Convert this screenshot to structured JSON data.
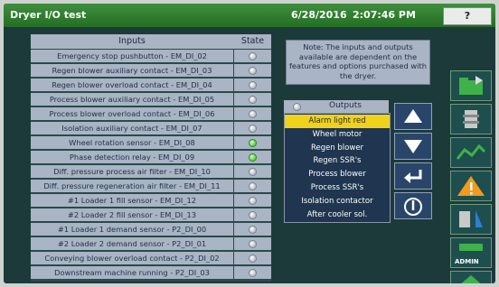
{
  "window": {
    "title": "Dryer I/O test",
    "date": "6/28/2016",
    "time": "2:07:46 PM",
    "help_label": "?"
  },
  "inputs_table": {
    "header_inputs": "Inputs",
    "header_state": "State",
    "rows": [
      {
        "label": "Emergency stop pushbutton - EM_DI_02",
        "on": false
      },
      {
        "label": "Regen blower auxiliary contact - EM_DI_03",
        "on": false
      },
      {
        "label": "Regen blower overload contact - EM_DI_04",
        "on": false
      },
      {
        "label": "Process blower auxiliary contact - EM_DI_05",
        "on": false
      },
      {
        "label": "Process blower overload contact - EM_DI_06",
        "on": false
      },
      {
        "label": "Isolation auxiliary contact - EM_DI_07",
        "on": false
      },
      {
        "label": "Wheel rotation sensor - EM_DI_08",
        "on": true
      },
      {
        "label": "Phase detection relay - EM_DI_09",
        "on": true
      },
      {
        "label": "Diff. pressure process air filter - EM_DI_10",
        "on": false
      },
      {
        "label": "Diff. pressure regeneration air filter - EM_DI_11",
        "on": false
      },
      {
        "label": "#1 Loader 1 fill sensor - EM_DI_12",
        "on": false
      },
      {
        "label": "#2 Loader 2 fill sensor - EM_DI_13",
        "on": false
      },
      {
        "label": "#1 Loader 1 demand sensor - P2_DI_00",
        "on": false
      },
      {
        "label": "#2 Loader 2 demand sensor - P2_DI_01",
        "on": false
      },
      {
        "label": "Conveying blower overload contact - P2_DI_02",
        "on": false
      },
      {
        "label": "Downstream machine running - P2_DI_03",
        "on": false
      }
    ]
  },
  "note": {
    "text": "Note: The inputs and outputs available are dependent on the features and options purchased with the dryer."
  },
  "outputs": {
    "header": "Outputs",
    "selected_index": 0,
    "items": [
      "Alarm light red",
      "Wheel motor",
      "Regen blower",
      "Regen SSR's",
      "Process blower",
      "Process SSR's",
      "Isolation contactor",
      "After cooler sol."
    ]
  },
  "side_buttons": {
    "up": "up-arrow-icon",
    "down": "down-arrow-icon",
    "enter": "enter-arrow-icon",
    "power": "power-icon"
  },
  "rail": {
    "admin_label": "ADMIN"
  }
}
